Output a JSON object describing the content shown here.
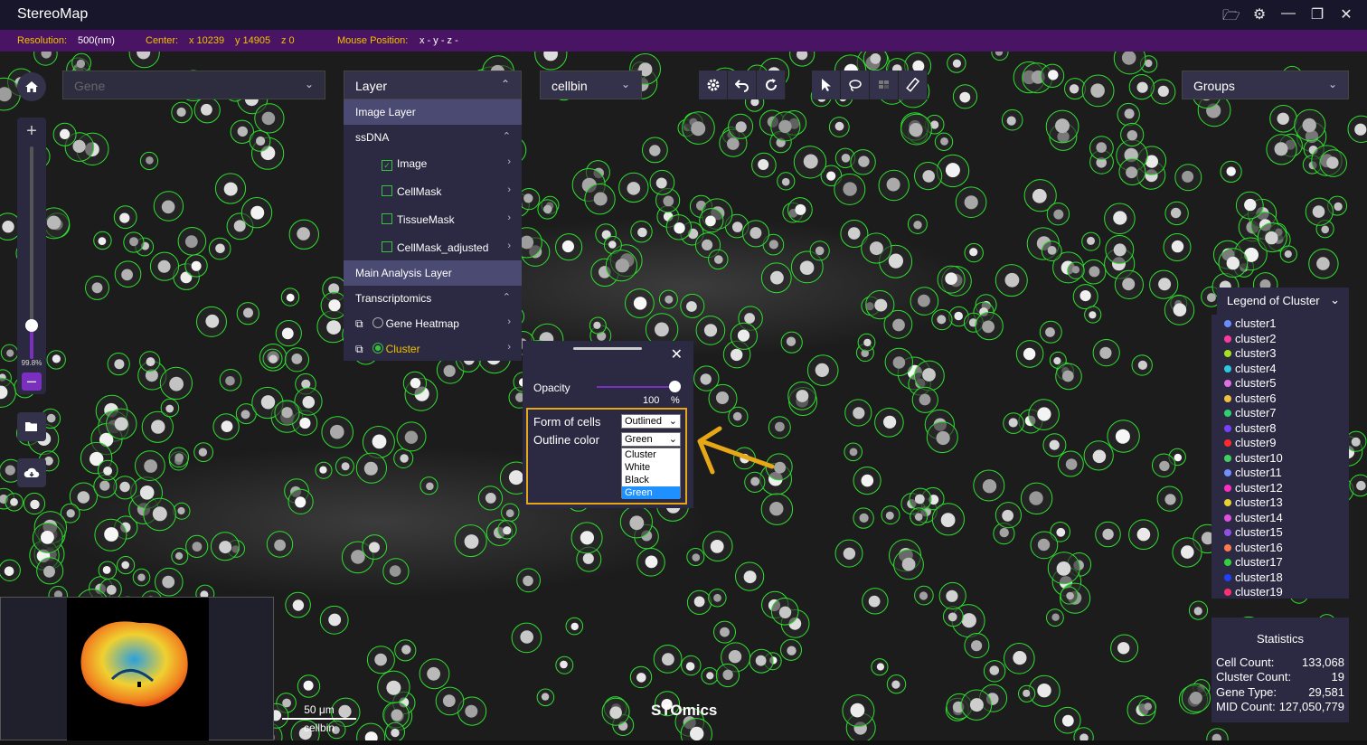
{
  "app": {
    "title": "StereoMap"
  },
  "window_icons": [
    "folder-icon",
    "settings-icon",
    "minimize-icon",
    "restore-icon",
    "close-icon"
  ],
  "infobar": {
    "resolution_label": "Resolution:",
    "resolution_value": "500(nm)",
    "center_label": "Center:",
    "center_x": "x 10239",
    "center_y": "y 14905",
    "center_z": "z 0",
    "mouse_label": "Mouse Position:",
    "mouse_value": "x -  y -  z -"
  },
  "gene_select": {
    "placeholder": "Gene"
  },
  "layer_select": {
    "label": "Layer"
  },
  "cellbin_select": {
    "label": "cellbin"
  },
  "groups_select": {
    "label": "Groups"
  },
  "zoom": {
    "percent": "99.8%",
    "level": 0.998
  },
  "layer_menu": {
    "image_layer": "Image Layer",
    "ssdna": "ssDNA",
    "image": "Image",
    "image_checked": true,
    "cellmask": "CellMask",
    "tissuemask": "TissueMask",
    "cellmask_adjusted": "CellMask_adjusted",
    "main_analysis": "Main Analysis Layer",
    "transcriptomics": "Transcriptomics",
    "gene_heatmap": "Gene Heatmap",
    "cluster": "Cluster"
  },
  "popup": {
    "opacity_label": "Opacity",
    "opacity_value": "100",
    "opacity_unit": "%",
    "form_label": "Form of cells",
    "form_value": "Outlined",
    "outline_label": "Outline color",
    "outline_value": "Green",
    "outline_options": [
      "Cluster",
      "White",
      "Black",
      "Green"
    ],
    "close": "✕"
  },
  "legend": {
    "title": "Legend of Cluster",
    "items": [
      {
        "label": "cluster1",
        "color": "#6b8cff"
      },
      {
        "label": "cluster2",
        "color": "#ff3aa0"
      },
      {
        "label": "cluster3",
        "color": "#a8e020"
      },
      {
        "label": "cluster4",
        "color": "#2ec8e0"
      },
      {
        "label": "cluster5",
        "color": "#e070e0"
      },
      {
        "label": "cluster6",
        "color": "#f0c040"
      },
      {
        "label": "cluster7",
        "color": "#30d070"
      },
      {
        "label": "cluster8",
        "color": "#7a40ff"
      },
      {
        "label": "cluster9",
        "color": "#ff2a2a"
      },
      {
        "label": "cluster10",
        "color": "#40d060"
      },
      {
        "label": "cluster11",
        "color": "#7090ff"
      },
      {
        "label": "cluster12",
        "color": "#ff30c0"
      },
      {
        "label": "cluster13",
        "color": "#e8d030"
      },
      {
        "label": "cluster14",
        "color": "#e050e0"
      },
      {
        "label": "cluster15",
        "color": "#9050e0"
      },
      {
        "label": "cluster16",
        "color": "#ff7a50"
      },
      {
        "label": "cluster17",
        "color": "#30d040"
      },
      {
        "label": "cluster18",
        "color": "#2040ff"
      },
      {
        "label": "cluster19",
        "color": "#ff3070"
      }
    ]
  },
  "stats": {
    "title": "Statistics",
    "cell_count_label": "Cell Count:",
    "cell_count": "133,068",
    "cluster_count_label": "Cluster Count:",
    "cluster_count": "19",
    "gene_type_label": "Gene Type:",
    "gene_type": "29,581",
    "mid_count_label": "MID Count:",
    "mid_count": "127,050,779"
  },
  "scalebar": {
    "length": "50 μm",
    "mode": "cellbin"
  },
  "watermark": "STOmics"
}
